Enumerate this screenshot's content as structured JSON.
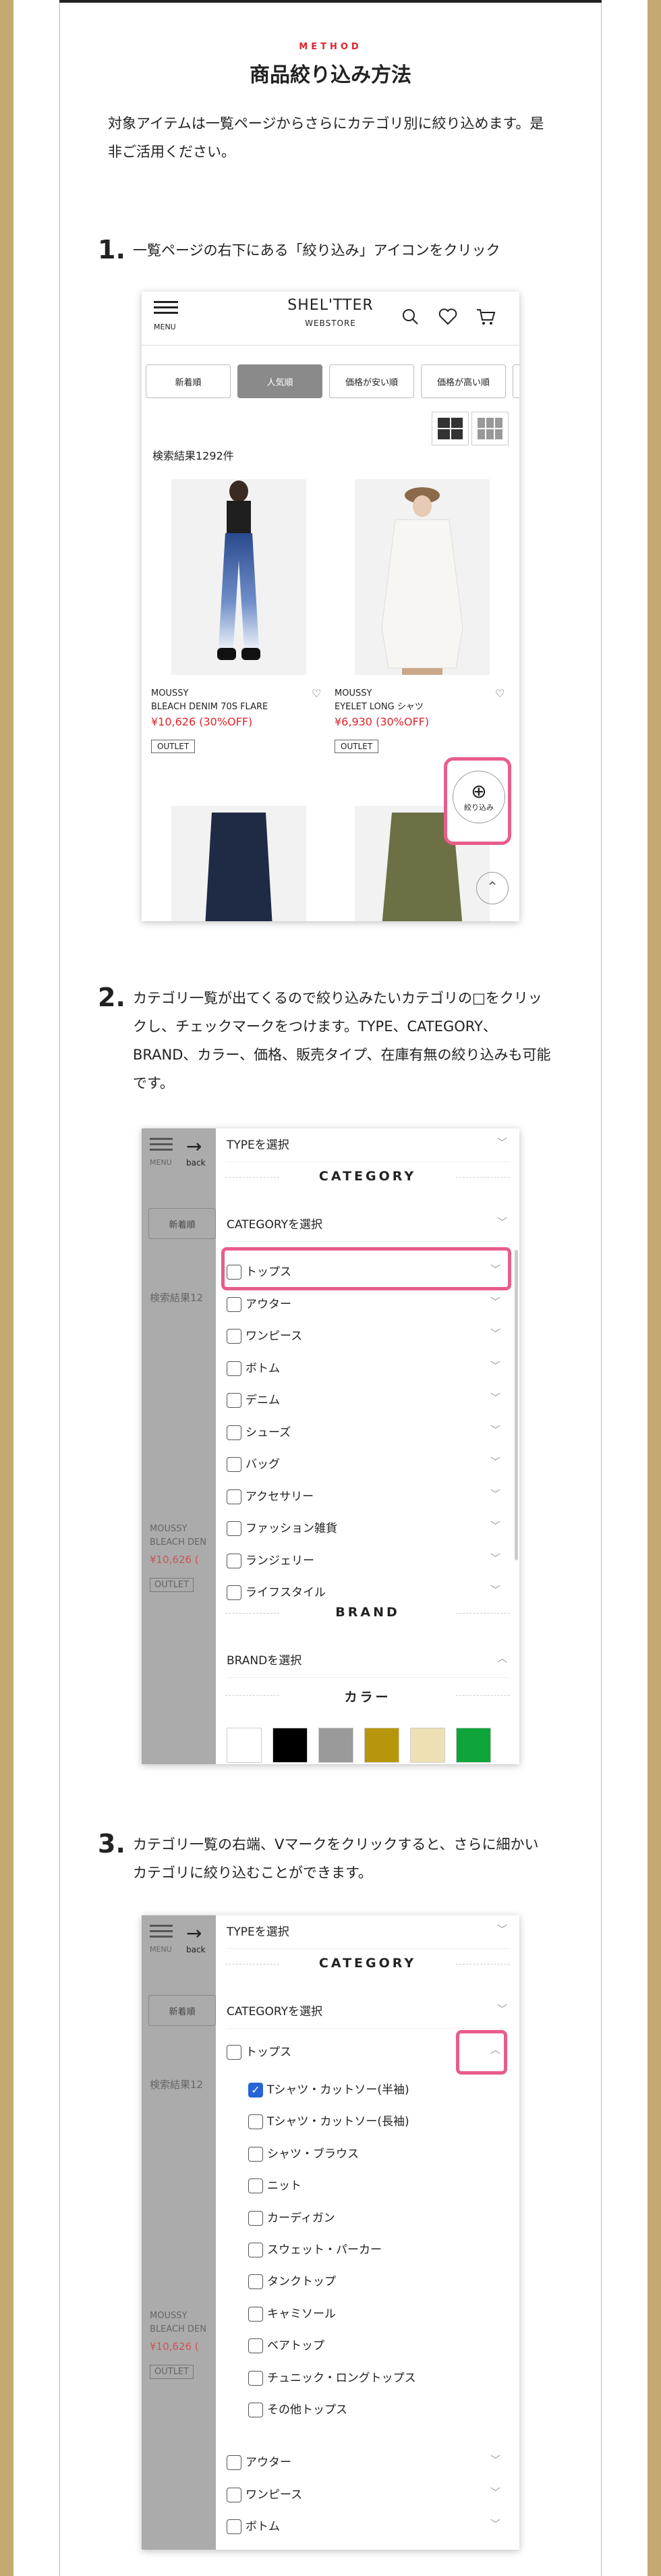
{
  "header": {
    "method": "METHOD",
    "title": "商品絞り込み方法"
  },
  "intro": "対象アイテムは一覧ページからさらにカテゴリ別に絞り込めます。是非ご活用ください。",
  "steps": [
    {
      "num": "1.",
      "text": "一覧ページの右下にある「絞り込み」アイコンをクリック"
    },
    {
      "num": "2.",
      "text": "カテゴリ一覧が出てくるので絞り込みたいカテゴリの□をクリックし、チェックマークをつけます。TYPE、CATEGORY、BRAND、カラー、価格、販売タイプ、在庫有無の絞り込みも可能です。"
    },
    {
      "num": "3.",
      "text": "カテゴリ一覧の右端、Vマークをクリックすると、さらに細かいカテゴリに絞り込むことができます。"
    }
  ],
  "phone1": {
    "menu": "MENU",
    "logo": "SHEL'TTER",
    "logo_sub": "WEBSTORE",
    "sort": [
      "新着順",
      "人気順",
      "価格が安い順",
      "価格が高い順"
    ],
    "count": "検索結果1292件",
    "products": [
      {
        "brand": "MOUSSY",
        "name": "BLEACH DENIM 70S FLARE",
        "price": "¥10,626 (30%OFF)",
        "badge": "OUTLET"
      },
      {
        "brand": "MOUSSY",
        "name": "EYELET LONG シャツ",
        "price": "¥6,930 (30%OFF)",
        "badge": "OUTLET"
      }
    ],
    "zoom_label": "絞り込み"
  },
  "phone2": {
    "menu": "MENU",
    "back": "back",
    "bg_sort": "新着順",
    "bg_count": "検索結果12",
    "bg_brand": "MOUSSY",
    "bg_name": "BLEACH DEN",
    "bg_price": "¥10,626 (",
    "bg_badge": "OUTLET",
    "type_select": "TYPEを選択",
    "category_head": "CATEGORY",
    "category_select": "CATEGORYを選択",
    "items": [
      "トップス",
      "アウター",
      "ワンピース",
      "ボトム",
      "デニム",
      "シューズ",
      "バッグ",
      "アクセサリー",
      "ファッション雑貨",
      "ランジェリー",
      "ライフスタイル"
    ],
    "brand_head": "BRAND",
    "brand_select": "BRANDを選択",
    "color_head": "カラー",
    "colors": [
      "#ffffff",
      "#000000",
      "#9a9a9a",
      "#b8960c",
      "#eee0b4",
      "#0fa53b"
    ]
  },
  "phone3": {
    "menu": "MENU",
    "back": "back",
    "bg_sort": "新着順",
    "bg_count": "検索結果12",
    "bg_brand": "MOUSSY",
    "bg_name": "BLEACH DEN",
    "bg_price": "¥10,626 (",
    "bg_badge": "OUTLET",
    "type_select": "TYPEを選択",
    "category_head": "CATEGORY",
    "category_select": "CATEGORYを選択",
    "tops": "トップス",
    "sub": [
      "Tシャツ・カットソー(半袖)",
      "Tシャツ・カットソー(長袖)",
      "シャツ・ブラウス",
      "ニット",
      "カーディガン",
      "スウェット・パーカー",
      "タンクトップ",
      "キャミソール",
      "ベアトップ",
      "チュニック・ロングトップス",
      "その他トップス"
    ],
    "rest": [
      "アウター",
      "ワンピース",
      "ボトム"
    ]
  }
}
